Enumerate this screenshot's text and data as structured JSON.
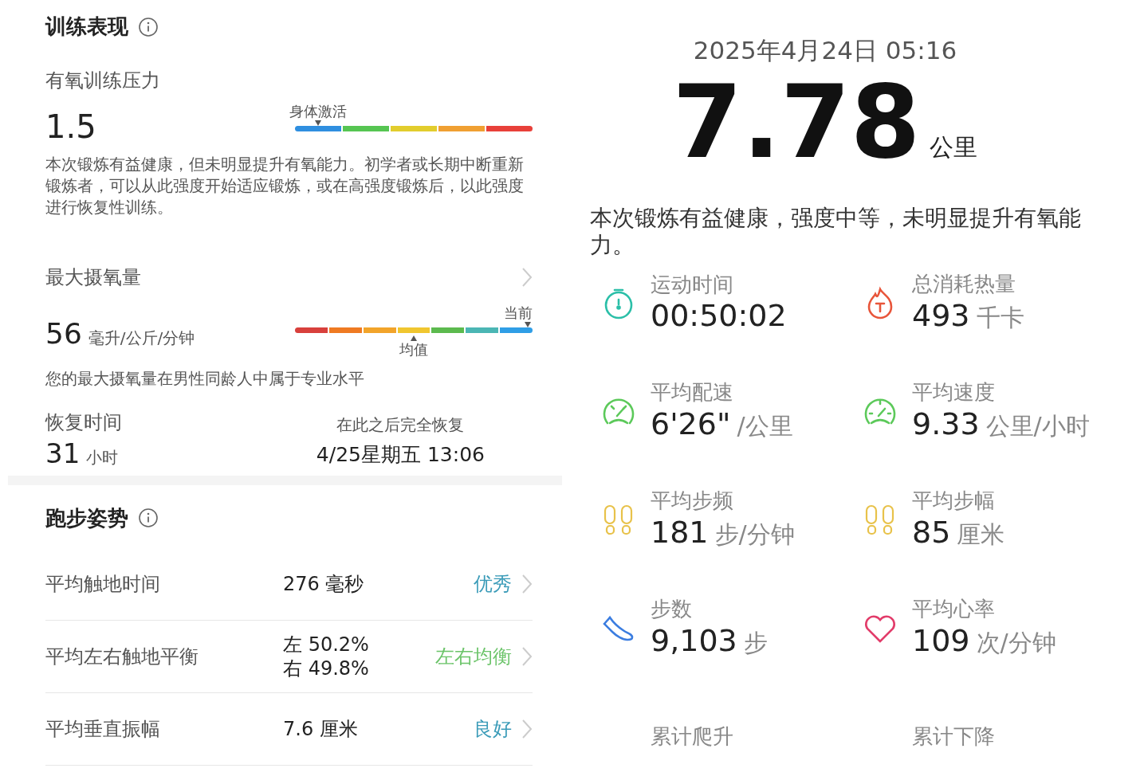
{
  "performance": {
    "title": "训练表现",
    "aerobic": {
      "label": "有氧训练压力",
      "value": "1.5",
      "marker_label": "身体激活",
      "segments": [
        {
          "color": "#2f8fe0",
          "selected": true
        },
        {
          "color": "#56c552",
          "selected": false
        },
        {
          "color": "#e2cd2d",
          "selected": false
        },
        {
          "color": "#f0a032",
          "selected": false
        },
        {
          "color": "#e8403a",
          "selected": false
        }
      ],
      "description": "本次锻炼有益健康，但未明显提升有氧能力。初学者或长期中断重新锻炼者，可以从此强度开始适应锻炼，或在高强度锻炼后，以此强度进行恢复性训练。"
    },
    "vo2max": {
      "label": "最大摄氧量",
      "value": "56",
      "unit": "毫升/公斤/分钟",
      "current_label": "当前",
      "average_label": "均值",
      "segments": [
        {
          "color": "#d8403c",
          "current": false,
          "average": false
        },
        {
          "color": "#ef7a22",
          "current": false,
          "average": false
        },
        {
          "color": "#f2a42a",
          "current": false,
          "average": false
        },
        {
          "color": "#f0c62f",
          "current": false,
          "average": true
        },
        {
          "color": "#5cba4e",
          "current": false,
          "average": false
        },
        {
          "color": "#4bb6b4",
          "current": false,
          "average": false
        },
        {
          "color": "#2f9ee6",
          "current": true,
          "average": false
        }
      ],
      "description": "您的最大摄氧量在男性同龄人中属于专业水平"
    },
    "recovery": {
      "label": "恢复时间",
      "value": "31",
      "unit": "小时",
      "full_label": "在此之后完全恢复",
      "full_time": "4/25星期五 13:06"
    }
  },
  "posture": {
    "title": "跑步姿势",
    "rows": [
      {
        "label": "平均触地时间",
        "values": [
          "276 毫秒"
        ],
        "rating": "优秀",
        "color": "#3a9bb8"
      },
      {
        "label": "平均左右触地平衡",
        "values": [
          "左 50.2%",
          "右 49.8%"
        ],
        "rating": "左右均衡",
        "color": "#6cc46a"
      },
      {
        "label": "平均垂直振幅",
        "values": [
          "7.6 厘米"
        ],
        "rating": "良好",
        "color": "#3a9bb8"
      }
    ]
  },
  "workout": {
    "datetime": "2025年4月24日 05:16",
    "distance": "7.78",
    "distance_unit": "公里",
    "summary": "本次锻炼有益健康，强度中等，未明显提升有氧能力。",
    "stats": [
      {
        "kind": "stopwatch",
        "label": "运动时间",
        "value": "00:50:02"
      },
      {
        "kind": "flame",
        "label": "总消耗热量",
        "value": "493",
        "unit": "千卡"
      },
      {
        "kind": "gauge",
        "label": "平均配速",
        "value": "6'26\"",
        "unit": "/公里"
      },
      {
        "kind": "speedometer",
        "label": "平均速度",
        "value": "9.33",
        "unit": "公里/小时"
      },
      {
        "kind": "footprints",
        "label": "平均步频",
        "value": "181",
        "unit": "步/分钟"
      },
      {
        "kind": "footprints",
        "label": "平均步幅",
        "value": "85",
        "unit": "厘米"
      },
      {
        "kind": "shoe",
        "label": "步数",
        "value": "9,103",
        "unit": "步"
      },
      {
        "kind": "heart",
        "label": "平均心率",
        "value": "109",
        "unit": "次/分钟"
      },
      {
        "label": "累计爬升"
      },
      {
        "label": "累计下降"
      }
    ]
  }
}
